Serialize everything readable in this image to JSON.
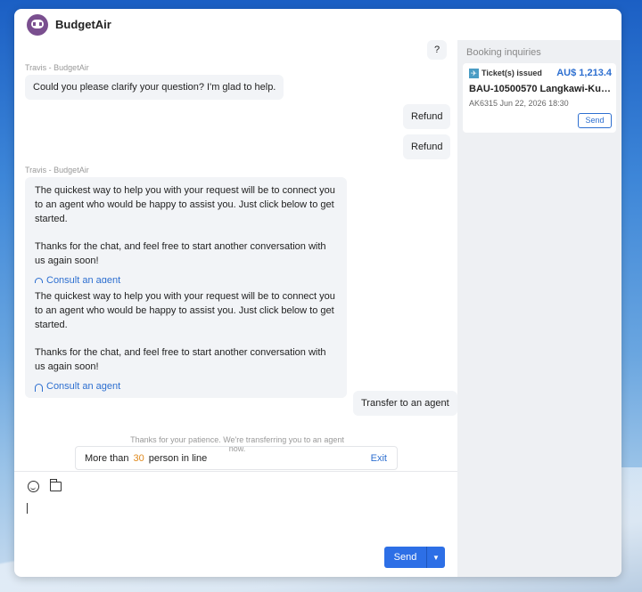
{
  "app": {
    "brand": "BudgetAir"
  },
  "chat": {
    "question_mark": "?",
    "sender_1": "Travis - BudgetAir",
    "bot_msg_1": "Could you please clarify your question? I'm glad to help.",
    "user_msg_1": "Refund",
    "user_msg_2": "Refund",
    "sender_2": "Travis - BudgetAir",
    "bot_msg_2": {
      "para1": "The quickest way to help you with your request will be to connect you to an agent who would be happy to assist you. Just click below to get started.",
      "para2": "Thanks for the chat, and feel free to start another conversation with us again soon!",
      "link": "Consult an agent"
    },
    "bot_msg_3": {
      "para1": "The quickest way to help you with your request will be to connect you to an agent who would be happy to assist you. Just click below to get started.",
      "para2": "Thanks for the chat, and feel free to start another conversation with us again soon!",
      "link": "Consult an agent"
    },
    "user_msg_3": "Transfer to an agent",
    "notice": "Thanks for your patience. We're transferring you to an agent now.",
    "queue": {
      "prefix": "More than",
      "count": "30",
      "suffix": "person in line",
      "exit": "Exit"
    }
  },
  "composer": {
    "send_label": "Send",
    "dropdown_icon": "caret-down-icon"
  },
  "booking": {
    "title": "Booking inquiries",
    "ticket": {
      "status": "Ticket(s) issued",
      "price": "AU$ 1,213.4",
      "route": "BAU-10500570 Langkawi-Kuala ...",
      "meta": "AK6315 Jun 22, 2026 18:30",
      "send": "Send"
    }
  },
  "colors": {
    "accent": "#2d6fe6",
    "queue_count": "#e08a1e",
    "brand_logo": "#7a4f8f"
  }
}
